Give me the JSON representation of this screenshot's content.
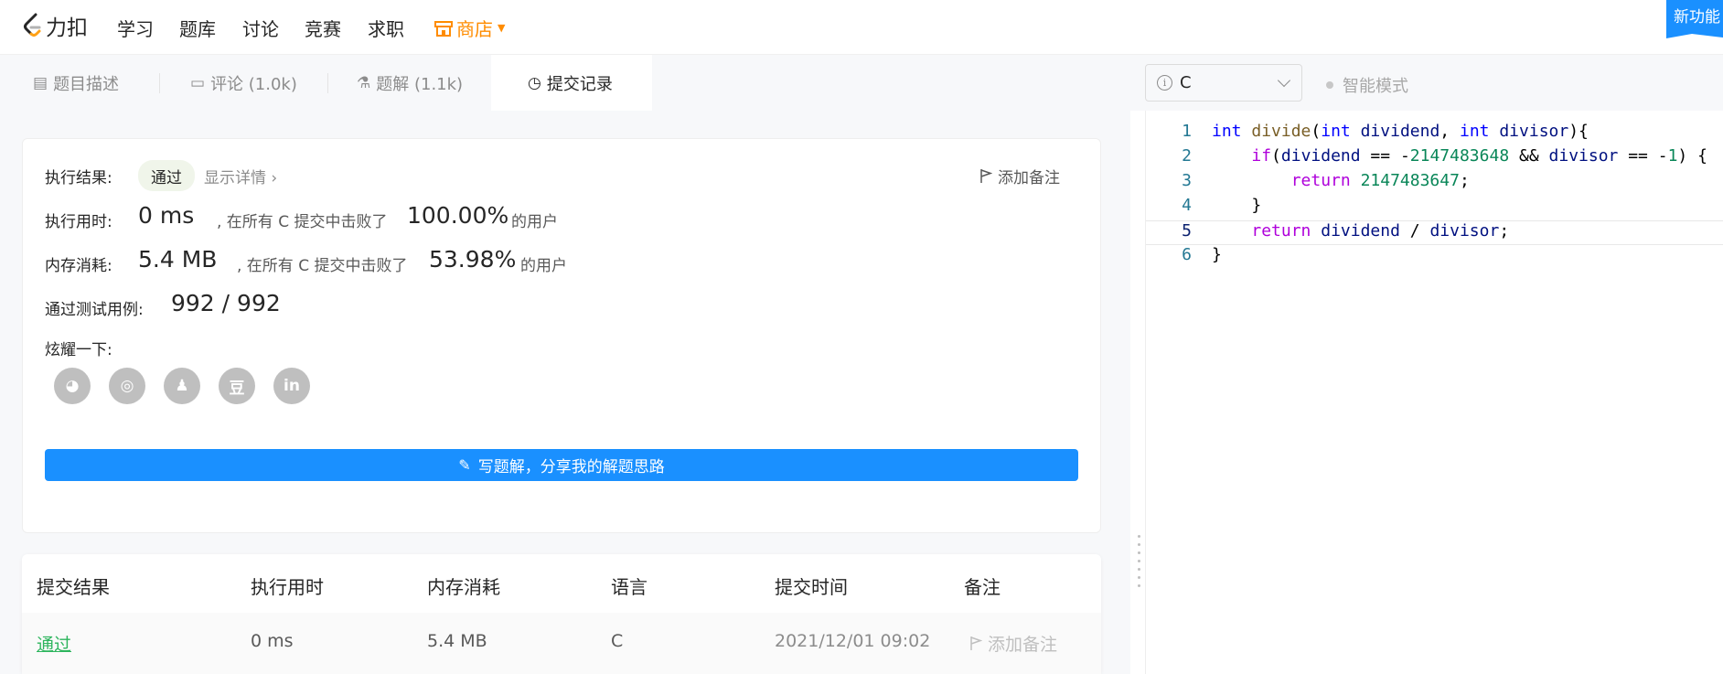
{
  "nav": {
    "logo_text": "力扣",
    "items": [
      "学习",
      "题库",
      "讨论",
      "竞赛",
      "求职"
    ],
    "store": "商店",
    "new_feature": "新功能"
  },
  "tabs": [
    {
      "label": "题目描述",
      "icon": "description-icon"
    },
    {
      "label": "评论 (1.0k)",
      "icon": "comment-icon"
    },
    {
      "label": "题解 (1.1k)",
      "icon": "flask-icon"
    },
    {
      "label": "提交记录",
      "icon": "clock-icon"
    }
  ],
  "editor_header": {
    "language": "C",
    "smart_mode": "智能模式"
  },
  "result": {
    "exec_result_label": "执行结果:",
    "status": "通过",
    "show_details": "显示详情 ›",
    "add_note": "添加备注",
    "runtime_label": "执行用时:",
    "runtime_value": "0 ms",
    "runtime_text": ", 在所有 C 提交中击败了",
    "runtime_percent": "100.00%",
    "users_text": "的用户",
    "memory_label": "内存消耗:",
    "memory_value": "5.4 MB",
    "memory_text": ", 在所有 C 提交中击败了",
    "memory_percent": "53.98%",
    "tests_label": "通过测试用例:",
    "tests_value": "992 / 992",
    "share_label": "炫耀一下:",
    "share_icons": [
      "wechat-icon",
      "weibo-icon",
      "qq-icon",
      "douban-icon",
      "linkedin-icon"
    ],
    "write_button": "写题解，分享我的解题思路"
  },
  "submissions": {
    "headers": [
      "提交结果",
      "执行用时",
      "内存消耗",
      "语言",
      "提交时间",
      "备注"
    ],
    "rows": [
      {
        "result": "通过",
        "runtime": "0 ms",
        "memory": "5.4 MB",
        "language": "C",
        "time": "2021/12/01 09:02",
        "note": "添加备注"
      }
    ]
  },
  "code": {
    "line_numbers": [
      "1",
      "2",
      "3",
      "4",
      "5",
      "6"
    ]
  }
}
